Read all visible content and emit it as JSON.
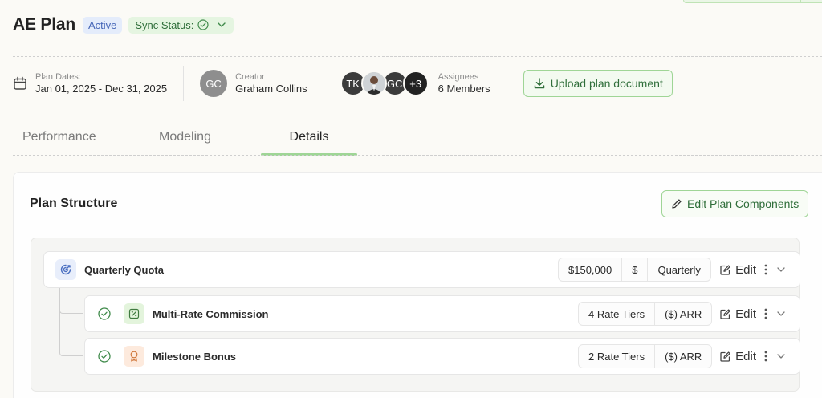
{
  "header": {
    "title": "AE Plan",
    "status_badge": "Active",
    "sync_label": "Sync Status:"
  },
  "meta": {
    "plan_dates_label": "Plan Dates:",
    "plan_dates_value": "Jan 01, 2025 - Dec 31, 2025",
    "creator_initials": "GC",
    "creator_label": "Creator",
    "creator_name": "Graham Collins",
    "assignee_avatars": [
      "TK",
      "GC",
      "+3"
    ],
    "assignees_label": "Assignees",
    "assignees_value": "6 Members",
    "upload_label": "Upload plan document"
  },
  "tabs": [
    {
      "label": "Performance",
      "active": false
    },
    {
      "label": "Modeling",
      "active": false
    },
    {
      "label": "Details",
      "active": true
    }
  ],
  "plan_structure": {
    "title": "Plan Structure",
    "edit_components_label": "Edit Plan Components",
    "quota": {
      "name": "Quarterly Quota",
      "chips": [
        "$150,000",
        "$",
        "Quarterly"
      ],
      "edit_label": "Edit",
      "icon": "target-icon"
    },
    "components": [
      {
        "name": "Multi-Rate Commission",
        "chips": [
          "4 Rate Tiers",
          "($) ARR"
        ],
        "edit_label": "Edit",
        "icon": "percent-icon"
      },
      {
        "name": "Milestone Bonus",
        "chips": [
          "2 Rate Tiers",
          "($) ARR"
        ],
        "edit_label": "Edit",
        "icon": "award-icon"
      }
    ]
  },
  "colors": {
    "accent_green": "#9fd596",
    "green_text": "#2f6e3a",
    "active_badge_bg": "#e4ecfb",
    "active_badge_text": "#4767b8",
    "quota_icon_bg": "#e8eefb",
    "commission_icon_bg": "#e3f4dc",
    "bonus_icon_bg": "#fdeadd"
  }
}
